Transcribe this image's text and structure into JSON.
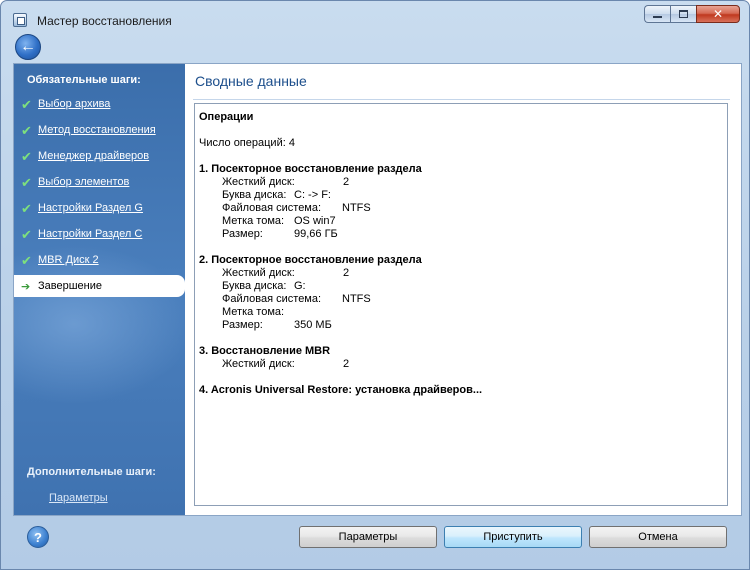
{
  "window": {
    "title": "Мастер восстановления"
  },
  "sidebar": {
    "required_heading": "Обязательные шаги:",
    "items": [
      {
        "label": "Выбор архива",
        "state": "done"
      },
      {
        "label": "Метод восстановления",
        "state": "done"
      },
      {
        "label": "Менеджер драйверов",
        "state": "done"
      },
      {
        "label": "Выбор элементов",
        "state": "done"
      },
      {
        "label": "Настройки Раздел G",
        "state": "done"
      },
      {
        "label": "Настройки Раздел C",
        "state": "done"
      },
      {
        "label": "MBR Диск 2",
        "state": "done"
      },
      {
        "label": "Завершение",
        "state": "current"
      }
    ],
    "optional_heading": "Дополнительные шаги:",
    "optional_link": "Параметры"
  },
  "content": {
    "title": "Сводные данные",
    "operations_heading": "Операции",
    "operations_count": "Число операций: 4",
    "op1": {
      "title": "1. Посекторное восстановление раздела",
      "disk_label": "Жесткий диск:",
      "disk_value": "2",
      "letter_label": "Буква диска:",
      "letter_value": "C: -> F:",
      "fs_label": "Файловая система:",
      "fs_value": "NTFS",
      "vol_label": "Метка тома:",
      "vol_value": "OS win7",
      "size_label": "Размер:",
      "size_value": "99,66 ГБ"
    },
    "op2": {
      "title": "2. Посекторное восстановление раздела",
      "disk_label": "Жесткий диск:",
      "disk_value": "2",
      "letter_label": "Буква диска:",
      "letter_value": "G:",
      "fs_label": "Файловая система:",
      "fs_value": "NTFS",
      "vol_label": "Метка тома:",
      "vol_value": "",
      "size_label": "Размер:",
      "size_value": "350 МБ"
    },
    "op3": {
      "title": "3. Восстановление MBR",
      "disk_label": "Жесткий диск:",
      "disk_value": "2"
    },
    "op4": {
      "title": "4. Acronis Universal Restore: установка драйверов..."
    }
  },
  "footer": {
    "help_glyph": "?",
    "params_label": "Параметры",
    "proceed_label": "Приступить",
    "cancel_label": "Отмена"
  }
}
